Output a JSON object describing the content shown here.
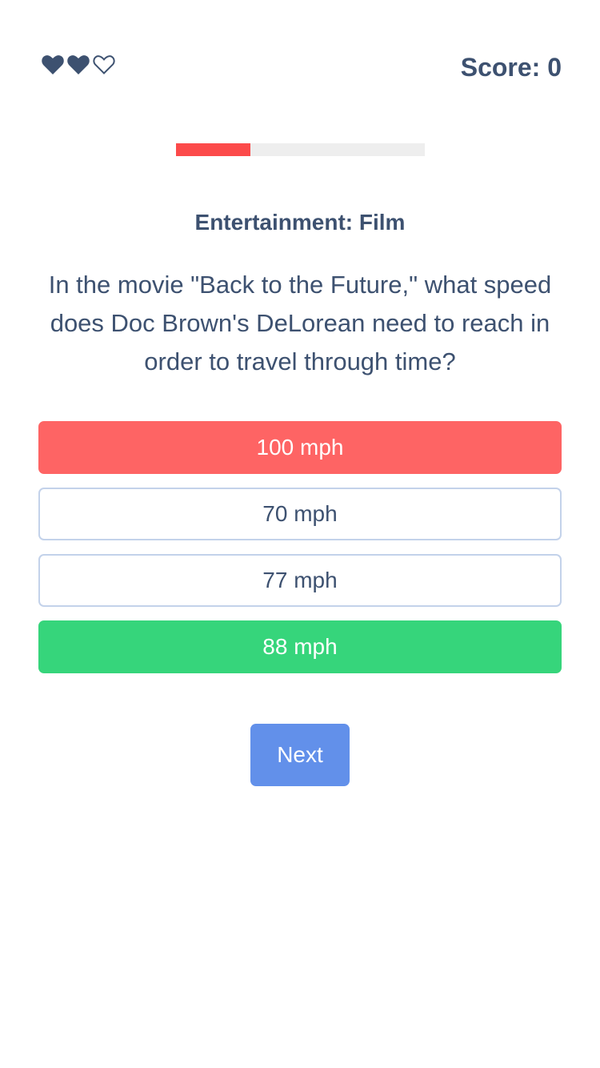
{
  "header": {
    "lives": [
      {
        "icon": "heart-filled-icon",
        "filled": true
      },
      {
        "icon": "heart-filled-icon",
        "filled": true
      },
      {
        "icon": "heart-outline-icon",
        "filled": false
      }
    ],
    "score_label": "Score: 0"
  },
  "progress": {
    "fraction": 0.3,
    "color": "#fc4a4a",
    "track_color": "#eeeeee"
  },
  "quiz": {
    "category": "Entertainment: Film",
    "question": "In the movie \"Back to the Future,\" what speed does Doc Brown's DeLorean need to reach in order to travel through time?",
    "answers": [
      {
        "label": "100 mph",
        "state": "wrong"
      },
      {
        "label": "70 mph",
        "state": "neutral"
      },
      {
        "label": "77 mph",
        "state": "neutral"
      },
      {
        "label": "88 mph",
        "state": "correct"
      }
    ],
    "next_label": "Next"
  },
  "colors": {
    "text": "#3d5170",
    "wrong": "#fe6464",
    "correct": "#36d57b",
    "button": "#6290ea",
    "answer_border": "#c3d2ea"
  }
}
